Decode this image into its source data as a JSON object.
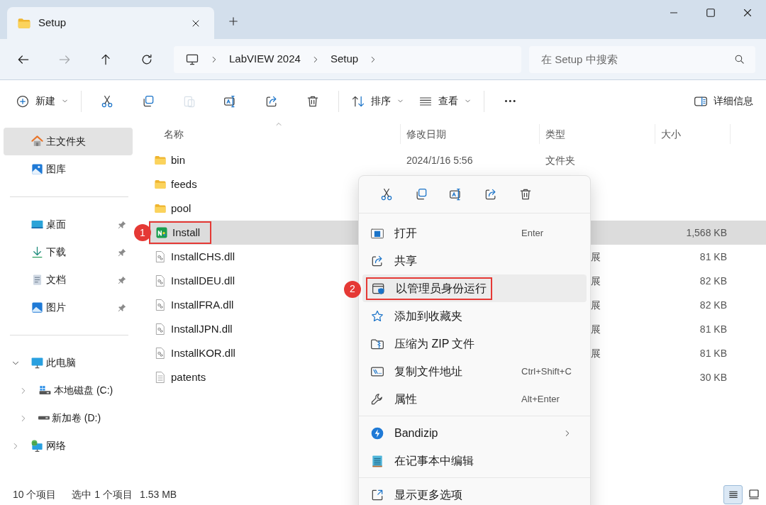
{
  "window": {
    "tab_title": "Setup"
  },
  "navigation": [
    {
      "kind": "back",
      "disabled": false
    },
    {
      "kind": "forward",
      "disabled": true
    },
    {
      "kind": "up",
      "disabled": false
    },
    {
      "kind": "refresh",
      "disabled": false
    }
  ],
  "address": {
    "breadcrumbs": [
      "LabVIEW 2024",
      "Setup"
    ]
  },
  "search": {
    "placeholder": "在 Setup 中搜索"
  },
  "toolbar": {
    "groups": [
      [
        {
          "kind": "new",
          "label": "新建",
          "dropdown": true,
          "disabled": false
        }
      ],
      [
        {
          "kind": "cut",
          "dropdown": false,
          "disabled": false
        },
        {
          "kind": "copy",
          "dropdown": false,
          "disabled": false
        },
        {
          "kind": "paste",
          "dropdown": false,
          "disabled": true
        },
        {
          "kind": "rename",
          "dropdown": false,
          "disabled": false
        },
        {
          "kind": "share",
          "dropdown": false,
          "disabled": false
        },
        {
          "kind": "delete",
          "dropdown": false,
          "disabled": false
        }
      ],
      [
        {
          "kind": "sort",
          "label": "排序",
          "dropdown": true,
          "disabled": false
        },
        {
          "kind": "view",
          "label": "查看",
          "dropdown": true,
          "disabled": false
        }
      ],
      [
        {
          "kind": "more",
          "dropdown": false,
          "disabled": false
        }
      ]
    ],
    "details_button": "详细信息"
  },
  "sidebar": {
    "sections": [
      [
        {
          "kind": "home",
          "label": "主文件夹",
          "selected": true
        },
        {
          "kind": "gallery",
          "label": "图库",
          "selected": false
        }
      ],
      [
        {
          "kind": "desktop",
          "label": "桌面",
          "selected": false,
          "pinned": true
        },
        {
          "kind": "download",
          "label": "下载",
          "selected": false,
          "pinned": true
        },
        {
          "kind": "document",
          "label": "文档",
          "selected": false,
          "pinned": true
        },
        {
          "kind": "pictures",
          "label": "图片",
          "selected": false,
          "pinned": true
        }
      ],
      [
        {
          "kind": "pc",
          "label": "此电脑",
          "selected": false,
          "expanded": true,
          "children": [
            {
              "kind": "drive-c",
              "label": "本地磁盘 (C:)",
              "selected": false,
              "expanded": false
            },
            {
              "kind": "drive",
              "label": "新加卷 (D:)",
              "selected": false,
              "expanded": false
            }
          ]
        },
        {
          "kind": "network",
          "label": "网络",
          "selected": false,
          "expanded": false
        }
      ]
    ]
  },
  "table": {
    "columns": [
      {
        "label": "名称",
        "sorted": true
      },
      {
        "label": "修改日期",
        "sorted": false
      },
      {
        "label": "类型",
        "sorted": false
      },
      {
        "label": "大小",
        "sorted": false
      }
    ],
    "rows": [
      {
        "kind": "folder",
        "name": "bin",
        "date": "2024/1/16 5:56",
        "type": "文件夹",
        "selected": false
      },
      {
        "kind": "folder",
        "name": "feeds",
        "selected": false
      },
      {
        "kind": "folder",
        "name": "pool",
        "selected": false
      },
      {
        "kind": "app",
        "name": "Install",
        "size": "1,568 KB",
        "selected": true,
        "callout": "1"
      },
      {
        "kind": "dll",
        "name": "InstallCHS.dll",
        "type": "展",
        "covered": true,
        "size": "81 KB",
        "selected": false
      },
      {
        "kind": "dll",
        "name": "InstallDEU.dll",
        "type": "展",
        "covered": true,
        "size": "82 KB",
        "selected": false
      },
      {
        "kind": "dll",
        "name": "InstallFRA.dll",
        "type": "展",
        "covered": true,
        "size": "82 KB",
        "selected": false
      },
      {
        "kind": "dll",
        "name": "InstallJPN.dll",
        "type": "展",
        "covered": true,
        "size": "81 KB",
        "selected": false
      },
      {
        "kind": "dll",
        "name": "InstallKOR.dll",
        "type": "展",
        "covered": true,
        "size": "81 KB",
        "selected": false
      },
      {
        "kind": "text",
        "name": "patents",
        "size": "30 KB",
        "selected": false
      }
    ]
  },
  "context_menu": {
    "quick_actions": [
      {
        "kind": "cut"
      },
      {
        "kind": "copy"
      },
      {
        "kind": "rename"
      },
      {
        "kind": "share"
      },
      {
        "kind": "delete"
      }
    ],
    "sections": [
      [
        {
          "kind": "open",
          "label": "打开",
          "shortcut": "Enter",
          "highlighted": false
        },
        {
          "kind": "share",
          "label": "共享",
          "highlighted": false
        },
        {
          "kind": "runas",
          "label": "以管理员身份运行",
          "highlighted": true,
          "callout": "2"
        },
        {
          "kind": "star",
          "label": "添加到收藏夹",
          "highlighted": false
        },
        {
          "kind": "zip",
          "label": "压缩为 ZIP 文件",
          "highlighted": false
        },
        {
          "kind": "path",
          "label": "复制文件地址",
          "shortcut": "Ctrl+Shift+C",
          "highlighted": false
        },
        {
          "kind": "wrench",
          "label": "属性",
          "shortcut": "Alt+Enter",
          "highlighted": false
        }
      ],
      [
        {
          "kind": "bandizip",
          "label": "Bandizip",
          "submenu": true,
          "highlighted": false
        },
        {
          "kind": "notepad",
          "label": "在记事本中编辑",
          "highlighted": false
        }
      ],
      [
        {
          "kind": "moreopts",
          "label": "显示更多选项",
          "highlighted": false
        }
      ]
    ]
  },
  "status_bar": {
    "item_count": "10 个项目",
    "selection": "选中 1 个项目",
    "selection_size": "1.53 MB",
    "view_buttons": [
      {
        "kind": "details",
        "selected": true
      },
      {
        "kind": "tiles",
        "selected": false
      }
    ]
  }
}
